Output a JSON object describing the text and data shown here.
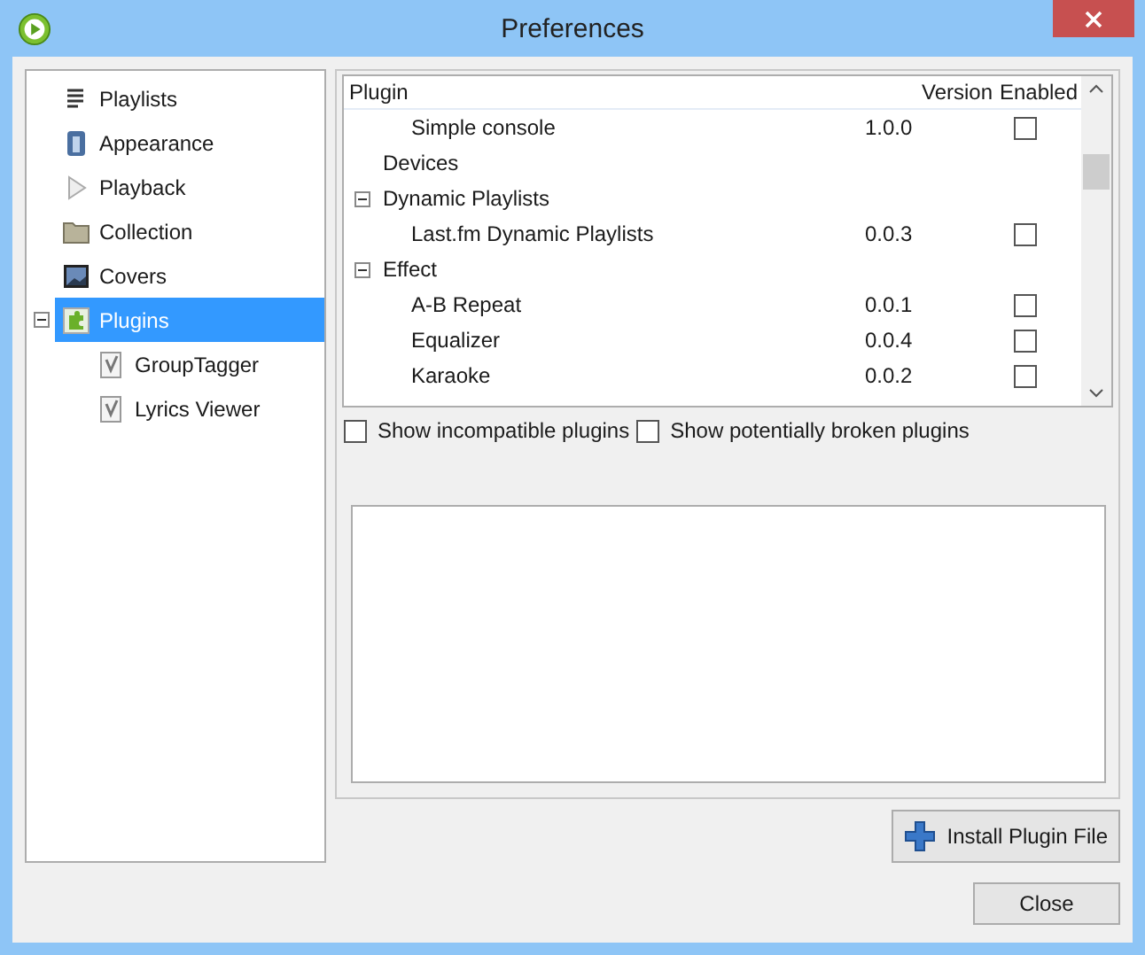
{
  "window": {
    "title": "Preferences"
  },
  "sidebar": {
    "items": [
      {
        "label": "Playlists",
        "selected": false
      },
      {
        "label": "Appearance",
        "selected": false
      },
      {
        "label": "Playback",
        "selected": false
      },
      {
        "label": "Collection",
        "selected": false
      },
      {
        "label": "Covers",
        "selected": false
      },
      {
        "label": "Plugins",
        "selected": true,
        "expanded": true,
        "children": [
          {
            "label": "GroupTagger",
            "selected": false
          },
          {
            "label": "Lyrics Viewer",
            "selected": false
          }
        ]
      }
    ]
  },
  "plugins_table": {
    "columns": [
      "Plugin",
      "Version",
      "Enabled"
    ],
    "rows": [
      {
        "kind": "plugin",
        "name": "Simple console",
        "version": "1.0.0",
        "enabled": false
      },
      {
        "kind": "category",
        "label": "Devices"
      },
      {
        "kind": "category",
        "label": "Dynamic Playlists",
        "expanded": true,
        "children": [
          {
            "kind": "plugin",
            "name": "Last.fm Dynamic Playlists",
            "version": "0.0.3",
            "enabled": false
          }
        ]
      },
      {
        "kind": "category",
        "label": "Effect",
        "expanded": true,
        "children": [
          {
            "kind": "plugin",
            "name": "A-B Repeat",
            "version": "0.0.1",
            "enabled": false
          },
          {
            "kind": "plugin",
            "name": "Equalizer",
            "version": "0.0.4",
            "enabled": false
          },
          {
            "kind": "plugin",
            "name": "Karaoke",
            "version": "0.0.2",
            "enabled": false
          }
        ]
      }
    ]
  },
  "options": [
    {
      "label": "Show incompatible plugins",
      "checked": false
    },
    {
      "label": "Show potentially broken plugins",
      "checked": false
    }
  ],
  "install_button": "Install Plugin File",
  "close_button": "Close"
}
